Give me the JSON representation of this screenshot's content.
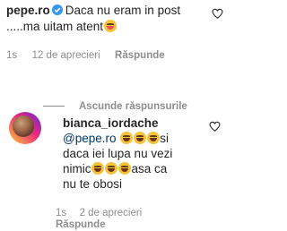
{
  "top_comment": {
    "username": "pepe.ro",
    "text_line1": "Daca nu eram in post",
    "text_line2": ".....ma uitam atent",
    "emoji_icon": "zany-face-emoji",
    "time": "1s",
    "likes": "12 de aprecieri",
    "reply_label": "Răspunde"
  },
  "hide_replies_label": "Ascunde răspunsurile",
  "reply_comment": {
    "username": "bianca_iordache",
    "mention": "@pepe.ro",
    "text_part1": "si",
    "text_part2": "daca iei lupa nu vezi",
    "text_part3": "nimic",
    "text_part4": "asa ca",
    "text_part5": "nu te obosi",
    "emoji_icon": "tears-of-joy-emoji",
    "time": "1s",
    "likes": "2 de aprecieri",
    "reply_label": "Răspunde"
  },
  "colors": {
    "text": "#262626",
    "secondary": "#8e8e8e",
    "mention": "#00376b",
    "verified": "#3897f0"
  }
}
